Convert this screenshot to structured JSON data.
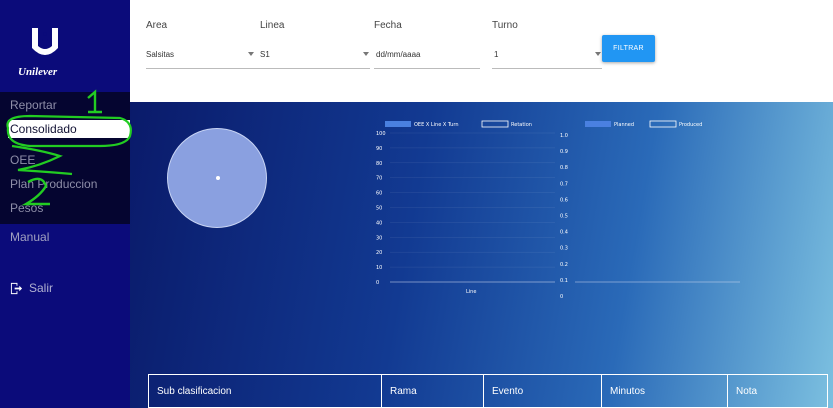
{
  "brand": {
    "logo_text": "Unilever"
  },
  "sidebar": {
    "items": [
      {
        "label": "Reportar"
      },
      {
        "label": "Consolidado"
      },
      {
        "label": "OEE"
      },
      {
        "label": "Plan Produccion"
      },
      {
        "label": "Pesos"
      },
      {
        "label": "Manual"
      }
    ],
    "logout_label": "Salir"
  },
  "filters": {
    "area": {
      "label": "Area",
      "value": "Salsitas"
    },
    "linea": {
      "label": "Linea",
      "value": "S1"
    },
    "fecha": {
      "label": "Fecha",
      "value": "dd/mm/aaaa"
    },
    "turno": {
      "label": "Turno",
      "value": "1"
    },
    "button_label": "FILTRAR"
  },
  "annotations": {
    "one": "1",
    "two": "2"
  },
  "chart_data": [
    {
      "type": "bar",
      "legend": [
        "OEE X Line X Turn",
        "Retation"
      ],
      "xlabel": "Line",
      "y_ticks": [
        100,
        90,
        80,
        70,
        60,
        50,
        40,
        30,
        20,
        10,
        0
      ],
      "y2_ticks": [
        1.0,
        0.9,
        0.8,
        0.7,
        0.6,
        0.5,
        0.4,
        0.3,
        0.2,
        0.1,
        0
      ],
      "ylim": [
        0,
        100
      ],
      "categories": [],
      "series": []
    },
    {
      "type": "bar",
      "legend": [
        "Planned",
        "Produced"
      ],
      "categories": [],
      "series": []
    }
  ],
  "table": {
    "columns": [
      "Sub clasificacion",
      "Rama",
      "Evento",
      "Minutos",
      "Nota"
    ]
  },
  "colors": {
    "sidebar": "#0b0b7a",
    "accent_button": "#2196f3",
    "annotation": "#22cc22"
  }
}
